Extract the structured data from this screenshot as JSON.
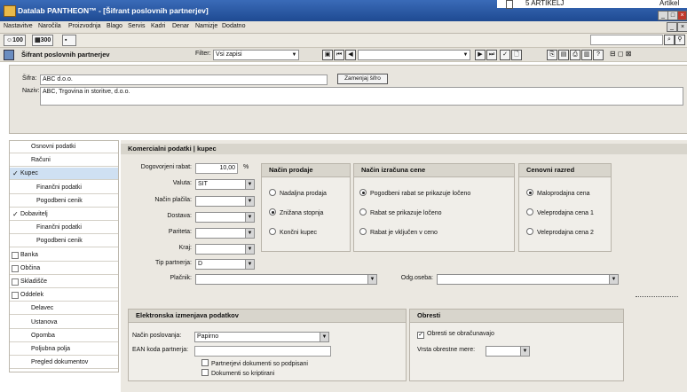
{
  "window": {
    "title": "Datalab PANTHEON™ - [Šifrant poslovnih partnerjev]",
    "strip_label": "5 ARTIKELJ",
    "strip_right": "Artikel"
  },
  "menu": [
    "Nastavitve",
    "Naročila",
    "Proizvodnja",
    "Blago",
    "Servis",
    "Kadri",
    "Denar",
    "Namizje",
    "Dodatno"
  ],
  "toolbar": {
    "btn1": "100",
    "btn2": "300"
  },
  "form": {
    "title": "Šifrant poslovnih partnerjev",
    "filter_label": "Filter:",
    "filter_value": "Vsi zapisi"
  },
  "partner": {
    "sifra_label": "Šifra:",
    "sifra_value": "ABC d.o.o.",
    "zamenjaj_label": "Zamenjaj šifro",
    "naziv_label": "Naziv:",
    "naziv_value": "ABC, Trgovina in storitve, d.o.o."
  },
  "nav": [
    {
      "label": "Osnovni podatki",
      "indent": false,
      "check": "none"
    },
    {
      "label": "Računi",
      "indent": false,
      "check": "none"
    },
    {
      "label": "Kupec",
      "indent": false,
      "check": "checked",
      "selected": true
    },
    {
      "label": "Finančni podatki",
      "indent": true,
      "check": "none"
    },
    {
      "label": "Pogodbeni cenik",
      "indent": true,
      "check": "none"
    },
    {
      "label": "Dobavitelj",
      "indent": false,
      "check": "checked"
    },
    {
      "label": "Finančni podatki",
      "indent": true,
      "check": "none"
    },
    {
      "label": "Pogodbeni cenik",
      "indent": true,
      "check": "none"
    },
    {
      "label": "Banka",
      "indent": false,
      "check": "box"
    },
    {
      "label": "Občina",
      "indent": false,
      "check": "box"
    },
    {
      "label": "Skladišče",
      "indent": false,
      "check": "box"
    },
    {
      "label": "Oddelek",
      "indent": false,
      "check": "box"
    },
    {
      "label": "Delavec",
      "indent": false,
      "check": "none"
    },
    {
      "label": "Ustanova",
      "indent": false,
      "check": "none"
    },
    {
      "label": "Opomba",
      "indent": false,
      "check": "none"
    },
    {
      "label": "Poljubna polja",
      "indent": false,
      "check": "none"
    },
    {
      "label": "Pregled dokumentov",
      "indent": false,
      "check": "none"
    }
  ],
  "commercial": {
    "header": "Komercialni podatki | kupec",
    "rabat_label": "Dogovorjeni rabat:",
    "rabat_value": "10,00",
    "rabat_unit": "%",
    "valuta_label": "Valuta:",
    "valuta_value": "SIT",
    "nacin_placila_label": "Način plačila:",
    "dostava_label": "Dostava:",
    "pariteta_label": "Pariteta:",
    "kraj_label": "Kraj:",
    "tip_label": "Tip partnerja:",
    "tip_value": "D",
    "placnik_label": "Plačnik:",
    "odg_label": "Odg.oseba:"
  },
  "nacin_prodaje": {
    "header": "Način prodaje",
    "options": [
      "Nadaljna prodaja",
      "Znižana stopnja",
      "Končni kupec"
    ],
    "selected": 1
  },
  "nacin_izracuna": {
    "header": "Način izračuna cene",
    "options": [
      "Pogodbeni rabat se prikazuje ločeno",
      "Rabat se prikazuje ločeno",
      "Rabat je vključen v ceno"
    ],
    "selected": 0
  },
  "cenovni_razred": {
    "header": "Cenovni razred",
    "options": [
      "Maloprodajna cena",
      "Veleprodajna cena 1",
      "Veleprodajna cena 2"
    ],
    "selected": 0
  },
  "edi": {
    "header": "Elektronska izmenjava podatkov",
    "nacin_label": "Način poslovanja:",
    "nacin_value": "Papirno",
    "ean_label": "EAN koda partnerja:",
    "chk1": "Partnerjevi dokumenti so podpisani",
    "chk2": "Dokumenti so kriptirani"
  },
  "obresti": {
    "header": "Obresti",
    "check_label": "Obresti se obračunavajo",
    "vrsta_label": "Vrsta obrestne mere:"
  }
}
